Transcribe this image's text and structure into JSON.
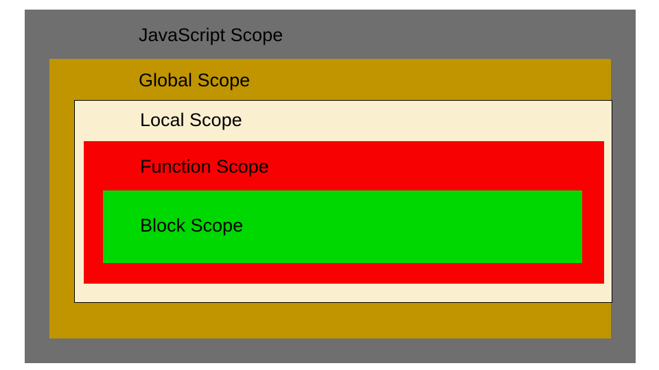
{
  "diagram": {
    "title": "JavaScript Scope",
    "levels": [
      {
        "name": "javascript-scope",
        "label": "JavaScript Scope",
        "color": "#6f6f6f"
      },
      {
        "name": "global-scope",
        "label": "Global Scope",
        "color": "#c09500"
      },
      {
        "name": "local-scope",
        "label": "Local Scope",
        "color": "#faf0d0"
      },
      {
        "name": "function-scope",
        "label": "Function Scope",
        "color": "#f80102"
      },
      {
        "name": "block-scope",
        "label": "Block Scope",
        "color": "#00d801"
      }
    ]
  }
}
